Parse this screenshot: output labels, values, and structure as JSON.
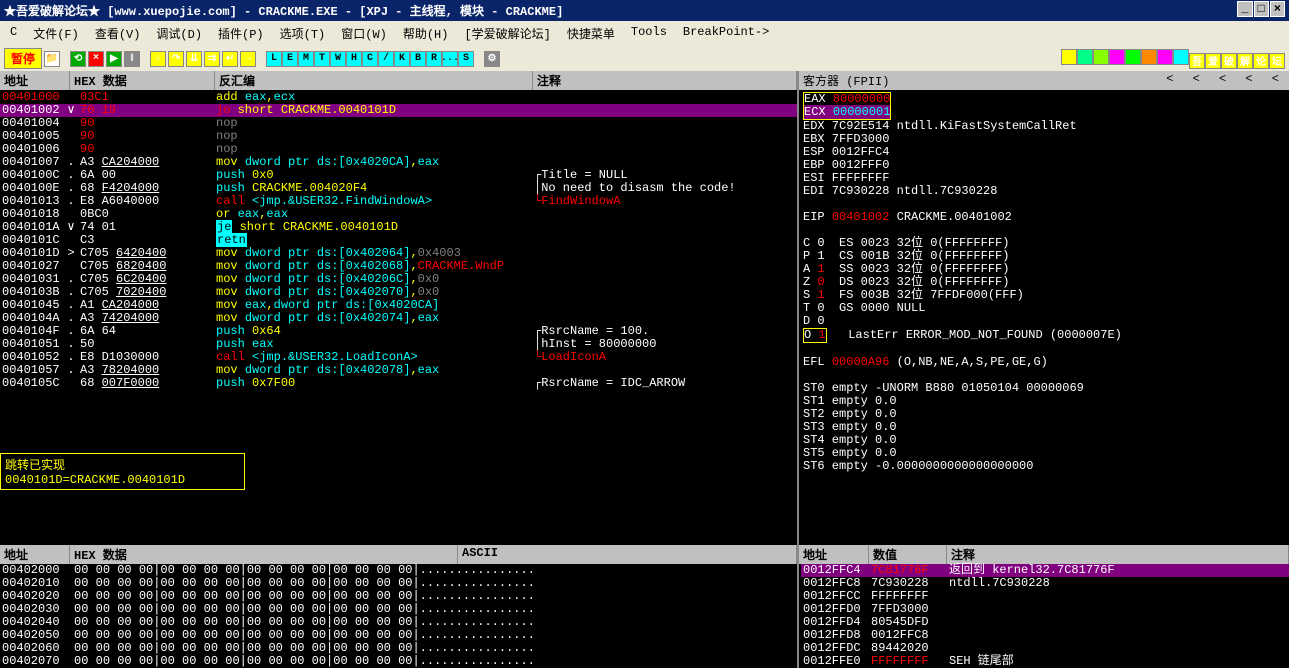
{
  "title": "★吾爱破解论坛★ [www.xuepojie.com]  - CRACKME.EXE - [XPJ -  主线程, 模块 - CRACKME]",
  "menu": [
    "文件(F)",
    "查看(V)",
    "调试(D)",
    "插件(P)",
    "选项(T)",
    "窗口(W)",
    "帮助(H)",
    "[学爱破解论坛]",
    "快捷菜单",
    "Tools",
    "BreakPoint->"
  ],
  "pause": "暂停",
  "toolbar_letters": [
    "L",
    "E",
    "M",
    "T",
    "W",
    "H",
    "C",
    "/",
    "K",
    "B",
    "R",
    "...",
    "S"
  ],
  "toolbar_right": [
    "吾",
    "爱",
    "破",
    "解",
    "论",
    "坛"
  ],
  "headers": {
    "addr": "地址",
    "hex": "HEX 数据",
    "dis": "反汇编",
    "cmt": "注释",
    "ascii": "ASCII",
    "val": "数值"
  },
  "reg_header": "客方器 (FPII)",
  "disasm": [
    {
      "a": "00401000",
      "aw": 0,
      "g": "",
      "h": [
        [
          "r",
          "03C1"
        ]
      ],
      "d": [
        [
          "y",
          "add "
        ],
        [
          "c",
          "eax"
        ],
        [
          "y",
          ","
        ],
        [
          "c",
          "ecx"
        ]
      ],
      "c": ""
    },
    {
      "a": "00401002",
      "aw": 1,
      "hl": 1,
      "g": "∨",
      "h": [
        [
          "r",
          "70 19"
        ]
      ],
      "d": [
        [
          "r",
          "jo "
        ],
        [
          "y",
          "short CRACKME.0040101D"
        ]
      ],
      "c": ""
    },
    {
      "a": "00401004",
      "aw": 1,
      "g": "",
      "h": [
        [
          "r",
          "90"
        ]
      ],
      "d": [
        [
          "g",
          "nop"
        ]
      ],
      "c": ""
    },
    {
      "a": "00401005",
      "aw": 1,
      "g": "",
      "h": [
        [
          "r",
          "90"
        ]
      ],
      "d": [
        [
          "g",
          "nop"
        ]
      ],
      "c": ""
    },
    {
      "a": "00401006",
      "aw": 1,
      "g": "",
      "h": [
        [
          "r",
          "90"
        ]
      ],
      "d": [
        [
          "g",
          "nop"
        ]
      ],
      "c": ""
    },
    {
      "a": "00401007",
      "aw": 1,
      "g": ".",
      "h": [
        [
          "w",
          "A3 "
        ],
        [
          "u",
          "CA204000"
        ]
      ],
      "d": [
        [
          "y",
          "mov "
        ],
        [
          "c",
          "dword ptr ds:[0x4020CA]"
        ],
        [
          "y",
          ","
        ],
        [
          "c",
          "eax"
        ]
      ],
      "c": ""
    },
    {
      "a": "0040100C",
      "aw": 1,
      "g": ".",
      "h": [
        [
          "w",
          "6A 00"
        ]
      ],
      "d": [
        [
          "c",
          "push "
        ],
        [
          "y",
          "0x0"
        ]
      ],
      "c": "┌Title = NULL"
    },
    {
      "a": "0040100E",
      "aw": 1,
      "g": ".",
      "h": [
        [
          "w",
          "68 "
        ],
        [
          "u",
          "F4204000"
        ]
      ],
      "d": [
        [
          "c",
          "push "
        ],
        [
          "y",
          "CRACKME.004020F4"
        ]
      ],
      "c": "│No need to disasm the code!"
    },
    {
      "a": "00401013",
      "aw": 1,
      "g": ".",
      "h": [
        [
          "w",
          "E8 A6040000"
        ]
      ],
      "d": [
        [
          "r",
          "call "
        ],
        [
          "c",
          "<jmp.&USER32.FindWindowA>"
        ]
      ],
      "c": "",
      "cr": "└FindWindowA"
    },
    {
      "a": "00401018",
      "aw": 1,
      "g": "",
      "h": [
        [
          "w",
          "0BC0"
        ]
      ],
      "d": [
        [
          "y",
          "or "
        ],
        [
          "c",
          "eax"
        ],
        [
          "y",
          ","
        ],
        [
          "c",
          "eax"
        ]
      ],
      "c": ""
    },
    {
      "a": "0040101A",
      "aw": 1,
      "g": "∨",
      "h": [
        [
          "w",
          "74 01"
        ]
      ],
      "d": [
        [
          "je",
          "je"
        ],
        [
          "y",
          " short CRACKME.0040101D"
        ]
      ],
      "c": ""
    },
    {
      "a": "0040101C",
      "aw": 1,
      "g": "",
      "h": [
        [
          "w",
          "C3"
        ]
      ],
      "d": [
        [
          "retn",
          "retn"
        ]
      ],
      "c": ""
    },
    {
      "a": "0040101D",
      "aw": 1,
      "g": ">",
      "h": [
        [
          "w",
          "C705 "
        ],
        [
          "u",
          "6420400"
        ]
      ],
      "d": [
        [
          "y",
          "mov "
        ],
        [
          "c",
          "dword ptr ds:[0x402064]"
        ],
        [
          "y",
          ","
        ],
        [
          "g",
          "0x4003"
        ]
      ],
      "c": ""
    },
    {
      "a": "00401027",
      "aw": 1,
      "g": "",
      "h": [
        [
          "w",
          "C705 "
        ],
        [
          "u",
          "6820400"
        ]
      ],
      "d": [
        [
          "y",
          "mov "
        ],
        [
          "c",
          "dword ptr ds:[0x402068]"
        ],
        [
          "y",
          ","
        ],
        [
          "r",
          "CRACKME.WndP"
        ]
      ],
      "c": ""
    },
    {
      "a": "00401031",
      "aw": 1,
      "g": ".",
      "h": [
        [
          "w",
          "C705 "
        ],
        [
          "u",
          "6C20400"
        ]
      ],
      "d": [
        [
          "y",
          "mov "
        ],
        [
          "c",
          "dword ptr ds:[0x40206C]"
        ],
        [
          "y",
          ","
        ],
        [
          "g",
          "0x0"
        ]
      ],
      "c": ""
    },
    {
      "a": "0040103B",
      "aw": 1,
      "g": ".",
      "h": [
        [
          "w",
          "C705 "
        ],
        [
          "u",
          "7020400"
        ]
      ],
      "d": [
        [
          "y",
          "mov "
        ],
        [
          "c",
          "dword ptr ds:[0x402070]"
        ],
        [
          "y",
          ","
        ],
        [
          "g",
          "0x0"
        ]
      ],
      "c": ""
    },
    {
      "a": "00401045",
      "aw": 1,
      "g": ".",
      "h": [
        [
          "w",
          "A1 "
        ],
        [
          "u",
          "CA204000"
        ]
      ],
      "d": [
        [
          "y",
          "mov "
        ],
        [
          "c",
          "eax"
        ],
        [
          "y",
          ","
        ],
        [
          "c",
          "dword ptr ds:[0x4020CA]"
        ]
      ],
      "c": ""
    },
    {
      "a": "0040104A",
      "aw": 1,
      "g": ".",
      "h": [
        [
          "w",
          "A3 "
        ],
        [
          "u",
          "74204000"
        ]
      ],
      "d": [
        [
          "y",
          "mov "
        ],
        [
          "c",
          "dword ptr ds:[0x402074]"
        ],
        [
          "y",
          ","
        ],
        [
          "c",
          "eax"
        ]
      ],
      "c": ""
    },
    {
      "a": "0040104F",
      "aw": 1,
      "g": ".",
      "h": [
        [
          "w",
          "6A 64"
        ]
      ],
      "d": [
        [
          "c",
          "push "
        ],
        [
          "y",
          "0x64"
        ]
      ],
      "c": "┌RsrcName = 100."
    },
    {
      "a": "00401051",
      "aw": 1,
      "g": ".",
      "h": [
        [
          "w",
          "50"
        ]
      ],
      "d": [
        [
          "c",
          "push "
        ],
        [
          "c",
          "eax"
        ]
      ],
      "c": "│hInst = 80000000"
    },
    {
      "a": "00401052",
      "aw": 1,
      "g": ".",
      "h": [
        [
          "w",
          "E8 D1030000"
        ]
      ],
      "d": [
        [
          "r",
          "call "
        ],
        [
          "c",
          "<jmp.&USER32.LoadIconA>"
        ]
      ],
      "c": "",
      "cr": "└LoadIconA"
    },
    {
      "a": "00401057",
      "aw": 1,
      "g": ".",
      "h": [
        [
          "w",
          "A3 "
        ],
        [
          "u",
          "78204000"
        ]
      ],
      "d": [
        [
          "y",
          "mov "
        ],
        [
          "c",
          "dword ptr ds:[0x402078]"
        ],
        [
          "y",
          ","
        ],
        [
          "c",
          "eax"
        ]
      ],
      "c": ""
    },
    {
      "a": "0040105C",
      "aw": 1,
      "g": "",
      "h": [
        [
          "w",
          "68 "
        ],
        [
          "u",
          "007F0000"
        ]
      ],
      "d": [
        [
          "c",
          "push "
        ],
        [
          "y",
          "0x7F00"
        ]
      ],
      "c": "┌RsrcName = IDC_ARROW"
    }
  ],
  "info": {
    "l1": "跳转已实现",
    "l2": "0040101D=CRACKME.0040101D"
  },
  "regs": {
    "eax": {
      "n": "EAX",
      "v": "80000000"
    },
    "ecx": {
      "n": "ECX",
      "v": "00000001"
    },
    "edx": "EDX 7C92E514 ntdll.KiFastSystemCallRet",
    "ebx": "EBX 7FFD3000",
    "esp": "ESP 0012FFC4",
    "ebp": "EBP 0012FFF0",
    "esi": "ESI FFFFFFFF",
    "edi": "EDI 7C930228 ntdll.7C930228",
    "eip_l": "EIP ",
    "eip_v": "00401002",
    "eip_t": " CRACKME.00401002",
    "flags": [
      "C 0  ES 0023 32位 0(FFFFFFFF)",
      "P 1  CS 001B 32位 0(FFFFFFFF)",
      [
        "A ",
        "1",
        "  SS 0023 32位 0(FFFFFFFF)"
      ],
      [
        "Z ",
        "0",
        "  DS 0023 32位 0(FFFFFFFF)"
      ],
      [
        "S ",
        "1",
        "  FS 003B 32位 7FFDF000(FFF)"
      ],
      "T 0  GS 0000 NULL",
      "D 0"
    ],
    "oflag": {
      "l": "O ",
      "v": "1",
      "t": "   LastErr ERROR_MOD_NOT_FOUND (0000007E)"
    },
    "efl_l": "EFL ",
    "efl_v": "00000A96",
    "efl_t": " (O,NB,NE,A,S,PE,GE,G)",
    "fpu": [
      "ST0 empty -UNORM B880 01050104 00000069",
      "ST1 empty 0.0",
      "ST2 empty 0.0",
      "ST3 empty 0.0",
      "ST4 empty 0.0",
      "ST5 empty 0.0",
      "ST6 empty -0.0000000000000000000"
    ]
  },
  "dump": [
    "00402000  00 00 00 00|00 00 00 00|00 00 00 00|00 00 00 00|................",
    "00402010  00 00 00 00|00 00 00 00|00 00 00 00|00 00 00 00|................",
    "00402020  00 00 00 00|00 00 00 00|00 00 00 00|00 00 00 00|................",
    "00402030  00 00 00 00|00 00 00 00|00 00 00 00|00 00 00 00|................",
    "00402040  00 00 00 00|00 00 00 00|00 00 00 00|00 00 00 00|................",
    "00402050  00 00 00 00|00 00 00 00|00 00 00 00|00 00 00 00|................",
    "00402060  00 00 00 00|00 00 00 00|00 00 00 00|00 00 00 00|................",
    "00402070  00 00 00 00|00 00 00 00|00 00 00 00|00 00 00 00|................"
  ],
  "stack": [
    {
      "a": "0012FFC4",
      "v": "7C81776F",
      "c": "返回到 kernel32.7C81776F",
      "hl": 1,
      "vr": 1
    },
    {
      "a": "0012FFC8",
      "v": "7C930228",
      "c": "ntdll.7C930228"
    },
    {
      "a": "0012FFCC",
      "v": "FFFFFFFF",
      "c": ""
    },
    {
      "a": "0012FFD0",
      "v": "7FFD3000",
      "c": ""
    },
    {
      "a": "0012FFD4",
      "v": "80545DFD",
      "c": ""
    },
    {
      "a": "0012FFD8",
      "v": "0012FFC8",
      "c": ""
    },
    {
      "a": "0012FFDC",
      "v": "89442020",
      "c": ""
    },
    {
      "a": "0012FFE0",
      "v": "FFFFFFFF",
      "c": "SEH 链尾部",
      "vr": 1
    }
  ]
}
